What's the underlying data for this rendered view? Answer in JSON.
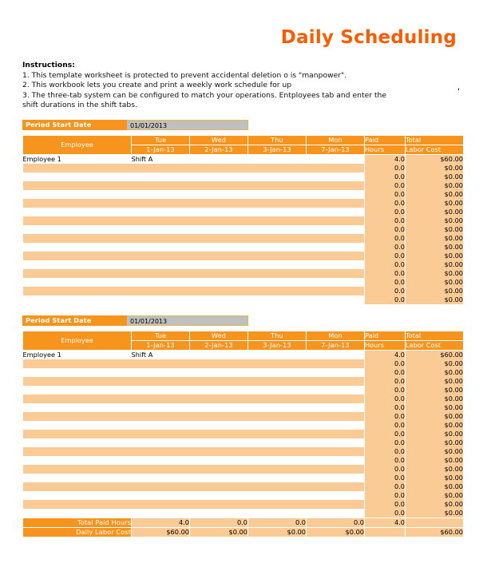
{
  "document": {
    "title": "Daily Scheduling"
  },
  "instructions": {
    "heading": "Instructions",
    "heading_colon": ":",
    "lines": [
      "1. This template worksheet is protected to prevent accidental deletion o is \"manpower\".",
      "2. This workbook lets you create and print a weekly work schedule for up",
      "3. The three-tab system can be configured to match your operations. Entployees tab and enter the shift durations in the shift tabs."
    ],
    "stray_mark": "'"
  },
  "colors": {
    "header_orange": "#F7941E",
    "title_orange": "#FA5D00",
    "row_peach": "#FBCB96",
    "date_gray": "#BFBFBF",
    "date_border": "#E8B84B",
    "white": "#FFFFFF"
  },
  "blocks": [
    {
      "period": {
        "label": "Period Start Date",
        "value": "01/01/2013"
      },
      "columns": {
        "employee": "Employee",
        "days": [
          {
            "name": "Tue",
            "date": "1-Jan-13"
          },
          {
            "name": "Wed",
            "date": "2-Jan-13"
          },
          {
            "name": "Thu",
            "date": "3-Jan-13"
          },
          {
            "name": "Mon",
            "date": "7-Jan-13"
          }
        ],
        "paid_hours_line1": "Paid",
        "paid_hours_line2": "Hours",
        "labor_cost_line1": "Total",
        "labor_cost_line2": "Labor Cost"
      },
      "rows": [
        {
          "employee": "Employee 1",
          "shifts": [
            "Shift A",
            "",
            "",
            ""
          ],
          "hours": "4.0",
          "cost": "$60.00"
        },
        {
          "employee": "",
          "shifts": [
            "",
            "",
            "",
            ""
          ],
          "hours": "0.0",
          "cost": "$0.00"
        },
        {
          "employee": "",
          "shifts": [
            "",
            "",
            "",
            ""
          ],
          "hours": "0.0",
          "cost": "$0.00"
        },
        {
          "employee": "",
          "shifts": [
            "",
            "",
            "",
            ""
          ],
          "hours": "0.0",
          "cost": "$0.00"
        },
        {
          "employee": "",
          "shifts": [
            "",
            "",
            "",
            ""
          ],
          "hours": "0.0",
          "cost": "$0.00"
        },
        {
          "employee": "",
          "shifts": [
            "",
            "",
            "",
            ""
          ],
          "hours": "0.0",
          "cost": "$0.00"
        },
        {
          "employee": "",
          "shifts": [
            "",
            "",
            "",
            ""
          ],
          "hours": "0.0",
          "cost": "$0.00"
        },
        {
          "employee": "",
          "shifts": [
            "",
            "",
            "",
            ""
          ],
          "hours": "0.0",
          "cost": "$0.00"
        },
        {
          "employee": "",
          "shifts": [
            "",
            "",
            "",
            ""
          ],
          "hours": "0.0",
          "cost": "$0.00"
        },
        {
          "employee": "",
          "shifts": [
            "",
            "",
            "",
            ""
          ],
          "hours": "0.0",
          "cost": "$0.00"
        },
        {
          "employee": "",
          "shifts": [
            "",
            "",
            "",
            ""
          ],
          "hours": "0.0",
          "cost": "$0.00"
        },
        {
          "employee": "",
          "shifts": [
            "",
            "",
            "",
            ""
          ],
          "hours": "0.0",
          "cost": "$0.00"
        },
        {
          "employee": "",
          "shifts": [
            "",
            "",
            "",
            ""
          ],
          "hours": "0.0",
          "cost": "$0.00"
        },
        {
          "employee": "",
          "shifts": [
            "",
            "",
            "",
            ""
          ],
          "hours": "0.0",
          "cost": "$0.00"
        },
        {
          "employee": "",
          "shifts": [
            "",
            "",
            "",
            ""
          ],
          "hours": "0.0",
          "cost": "$0.00"
        },
        {
          "employee": "",
          "shifts": [
            "",
            "",
            "",
            ""
          ],
          "hours": "0.0",
          "cost": "$0.00"
        },
        {
          "employee": "",
          "shifts": [
            "",
            "",
            "",
            ""
          ],
          "hours": "0.0",
          "cost": "$0.00"
        }
      ],
      "summary": []
    },
    {
      "period": {
        "label": "Period Start Date",
        "value": "01/01/2013"
      },
      "columns": {
        "employee": "Employee",
        "days": [
          {
            "name": "Tue",
            "date": "1-Jan-13"
          },
          {
            "name": "Wed",
            "date": "2-Jan-13"
          },
          {
            "name": "Thu",
            "date": "3-Jan-13"
          },
          {
            "name": "Mon",
            "date": "7-Jan-13"
          }
        ],
        "paid_hours_line1": "Paid",
        "paid_hours_line2": "Hours",
        "labor_cost_line1": "Total",
        "labor_cost_line2": "Labor Cost"
      },
      "rows": [
        {
          "employee": "Employee 1",
          "shifts": [
            "Shift A",
            "",
            "",
            ""
          ],
          "hours": "4.0",
          "cost": "$60.00"
        },
        {
          "employee": "",
          "shifts": [
            "",
            "",
            "",
            ""
          ],
          "hours": "0.0",
          "cost": "$0.00"
        },
        {
          "employee": "",
          "shifts": [
            "",
            "",
            "",
            ""
          ],
          "hours": "0.0",
          "cost": "$0.00"
        },
        {
          "employee": "",
          "shifts": [
            "",
            "",
            "",
            ""
          ],
          "hours": "0.0",
          "cost": "$0.00"
        },
        {
          "employee": "",
          "shifts": [
            "",
            "",
            "",
            ""
          ],
          "hours": "0.0",
          "cost": "$0.00"
        },
        {
          "employee": "",
          "shifts": [
            "",
            "",
            "",
            ""
          ],
          "hours": "0.0",
          "cost": "$0.00"
        },
        {
          "employee": "",
          "shifts": [
            "",
            "",
            "",
            ""
          ],
          "hours": "0.0",
          "cost": "$0.00"
        },
        {
          "employee": "",
          "shifts": [
            "",
            "",
            "",
            ""
          ],
          "hours": "0.0",
          "cost": "$0.00"
        },
        {
          "employee": "",
          "shifts": [
            "",
            "",
            "",
            ""
          ],
          "hours": "0.0",
          "cost": "$0.00"
        },
        {
          "employee": "",
          "shifts": [
            "",
            "",
            "",
            ""
          ],
          "hours": "0.0",
          "cost": "$0.00"
        },
        {
          "employee": "",
          "shifts": [
            "",
            "",
            "",
            ""
          ],
          "hours": "0.0",
          "cost": "$0.00"
        },
        {
          "employee": "",
          "shifts": [
            "",
            "",
            "",
            ""
          ],
          "hours": "0.0",
          "cost": "$0.00"
        },
        {
          "employee": "",
          "shifts": [
            "",
            "",
            "",
            ""
          ],
          "hours": "0.0",
          "cost": "$0.00"
        },
        {
          "employee": "",
          "shifts": [
            "",
            "",
            "",
            ""
          ],
          "hours": "0.0",
          "cost": "$0.00"
        },
        {
          "employee": "",
          "shifts": [
            "",
            "",
            "",
            ""
          ],
          "hours": "0.0",
          "cost": "$0.00"
        },
        {
          "employee": "",
          "shifts": [
            "",
            "",
            "",
            ""
          ],
          "hours": "0.0",
          "cost": "$0.00"
        },
        {
          "employee": "",
          "shifts": [
            "",
            "",
            "",
            ""
          ],
          "hours": "0.0",
          "cost": "$0.00"
        },
        {
          "employee": "",
          "shifts": [
            "",
            "",
            "",
            ""
          ],
          "hours": "0.0",
          "cost": "$0.00"
        },
        {
          "employee": "",
          "shifts": [
            "",
            "",
            "",
            ""
          ],
          "hours": "0.0",
          "cost": "$0.00"
        }
      ],
      "summary": [
        {
          "label": "Total Paid Hours",
          "values": [
            "4.0",
            "0.0",
            "0.0",
            "0.0"
          ],
          "hours": "4.0",
          "cost": ""
        },
        {
          "label": "Daily Labor Cost",
          "values": [
            "$60.00",
            "$0.00",
            "$0.00",
            "$0.00"
          ],
          "hours": "",
          "cost": "$60.00"
        }
      ]
    }
  ]
}
